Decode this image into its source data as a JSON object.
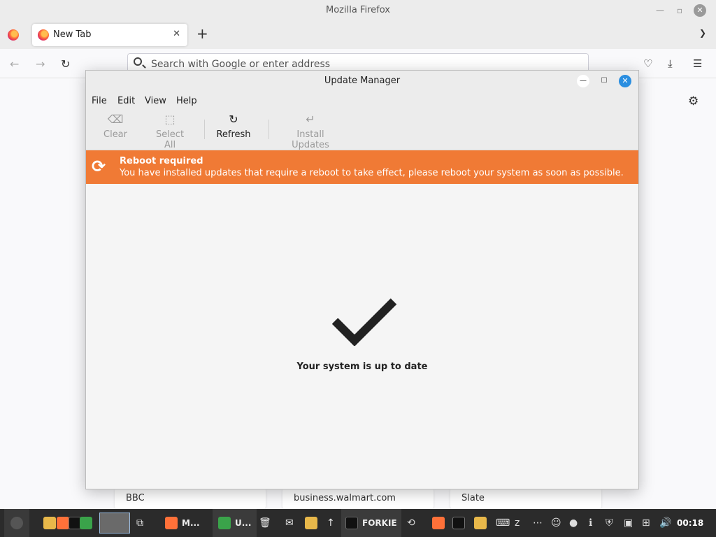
{
  "firefox": {
    "window_title": "Mozilla Firefox",
    "tab_label": "New Tab",
    "tab_close": "✕",
    "new_tab": "+",
    "url_placeholder": "Search with Google or enter address",
    "shortcuts": [
      "BBC",
      "business.walmart.com",
      "Slate"
    ]
  },
  "dialog": {
    "title": "Update Manager",
    "menu": [
      "File",
      "Edit",
      "View",
      "Help"
    ],
    "toolbar": {
      "clear": "Clear",
      "select_all": "Select All",
      "refresh": "Refresh",
      "install": "Install Updates"
    },
    "banner": {
      "title": "Reboot required",
      "message": "You have installed updates that require a reboot to take effect, please reboot your system as soon as possible.",
      "color": "#f07a35"
    },
    "status": "Your system is up to date"
  },
  "taskbar": {
    "tasks": [
      "M...",
      "U...",
      "FORKIE"
    ],
    "clock": "00:18"
  }
}
